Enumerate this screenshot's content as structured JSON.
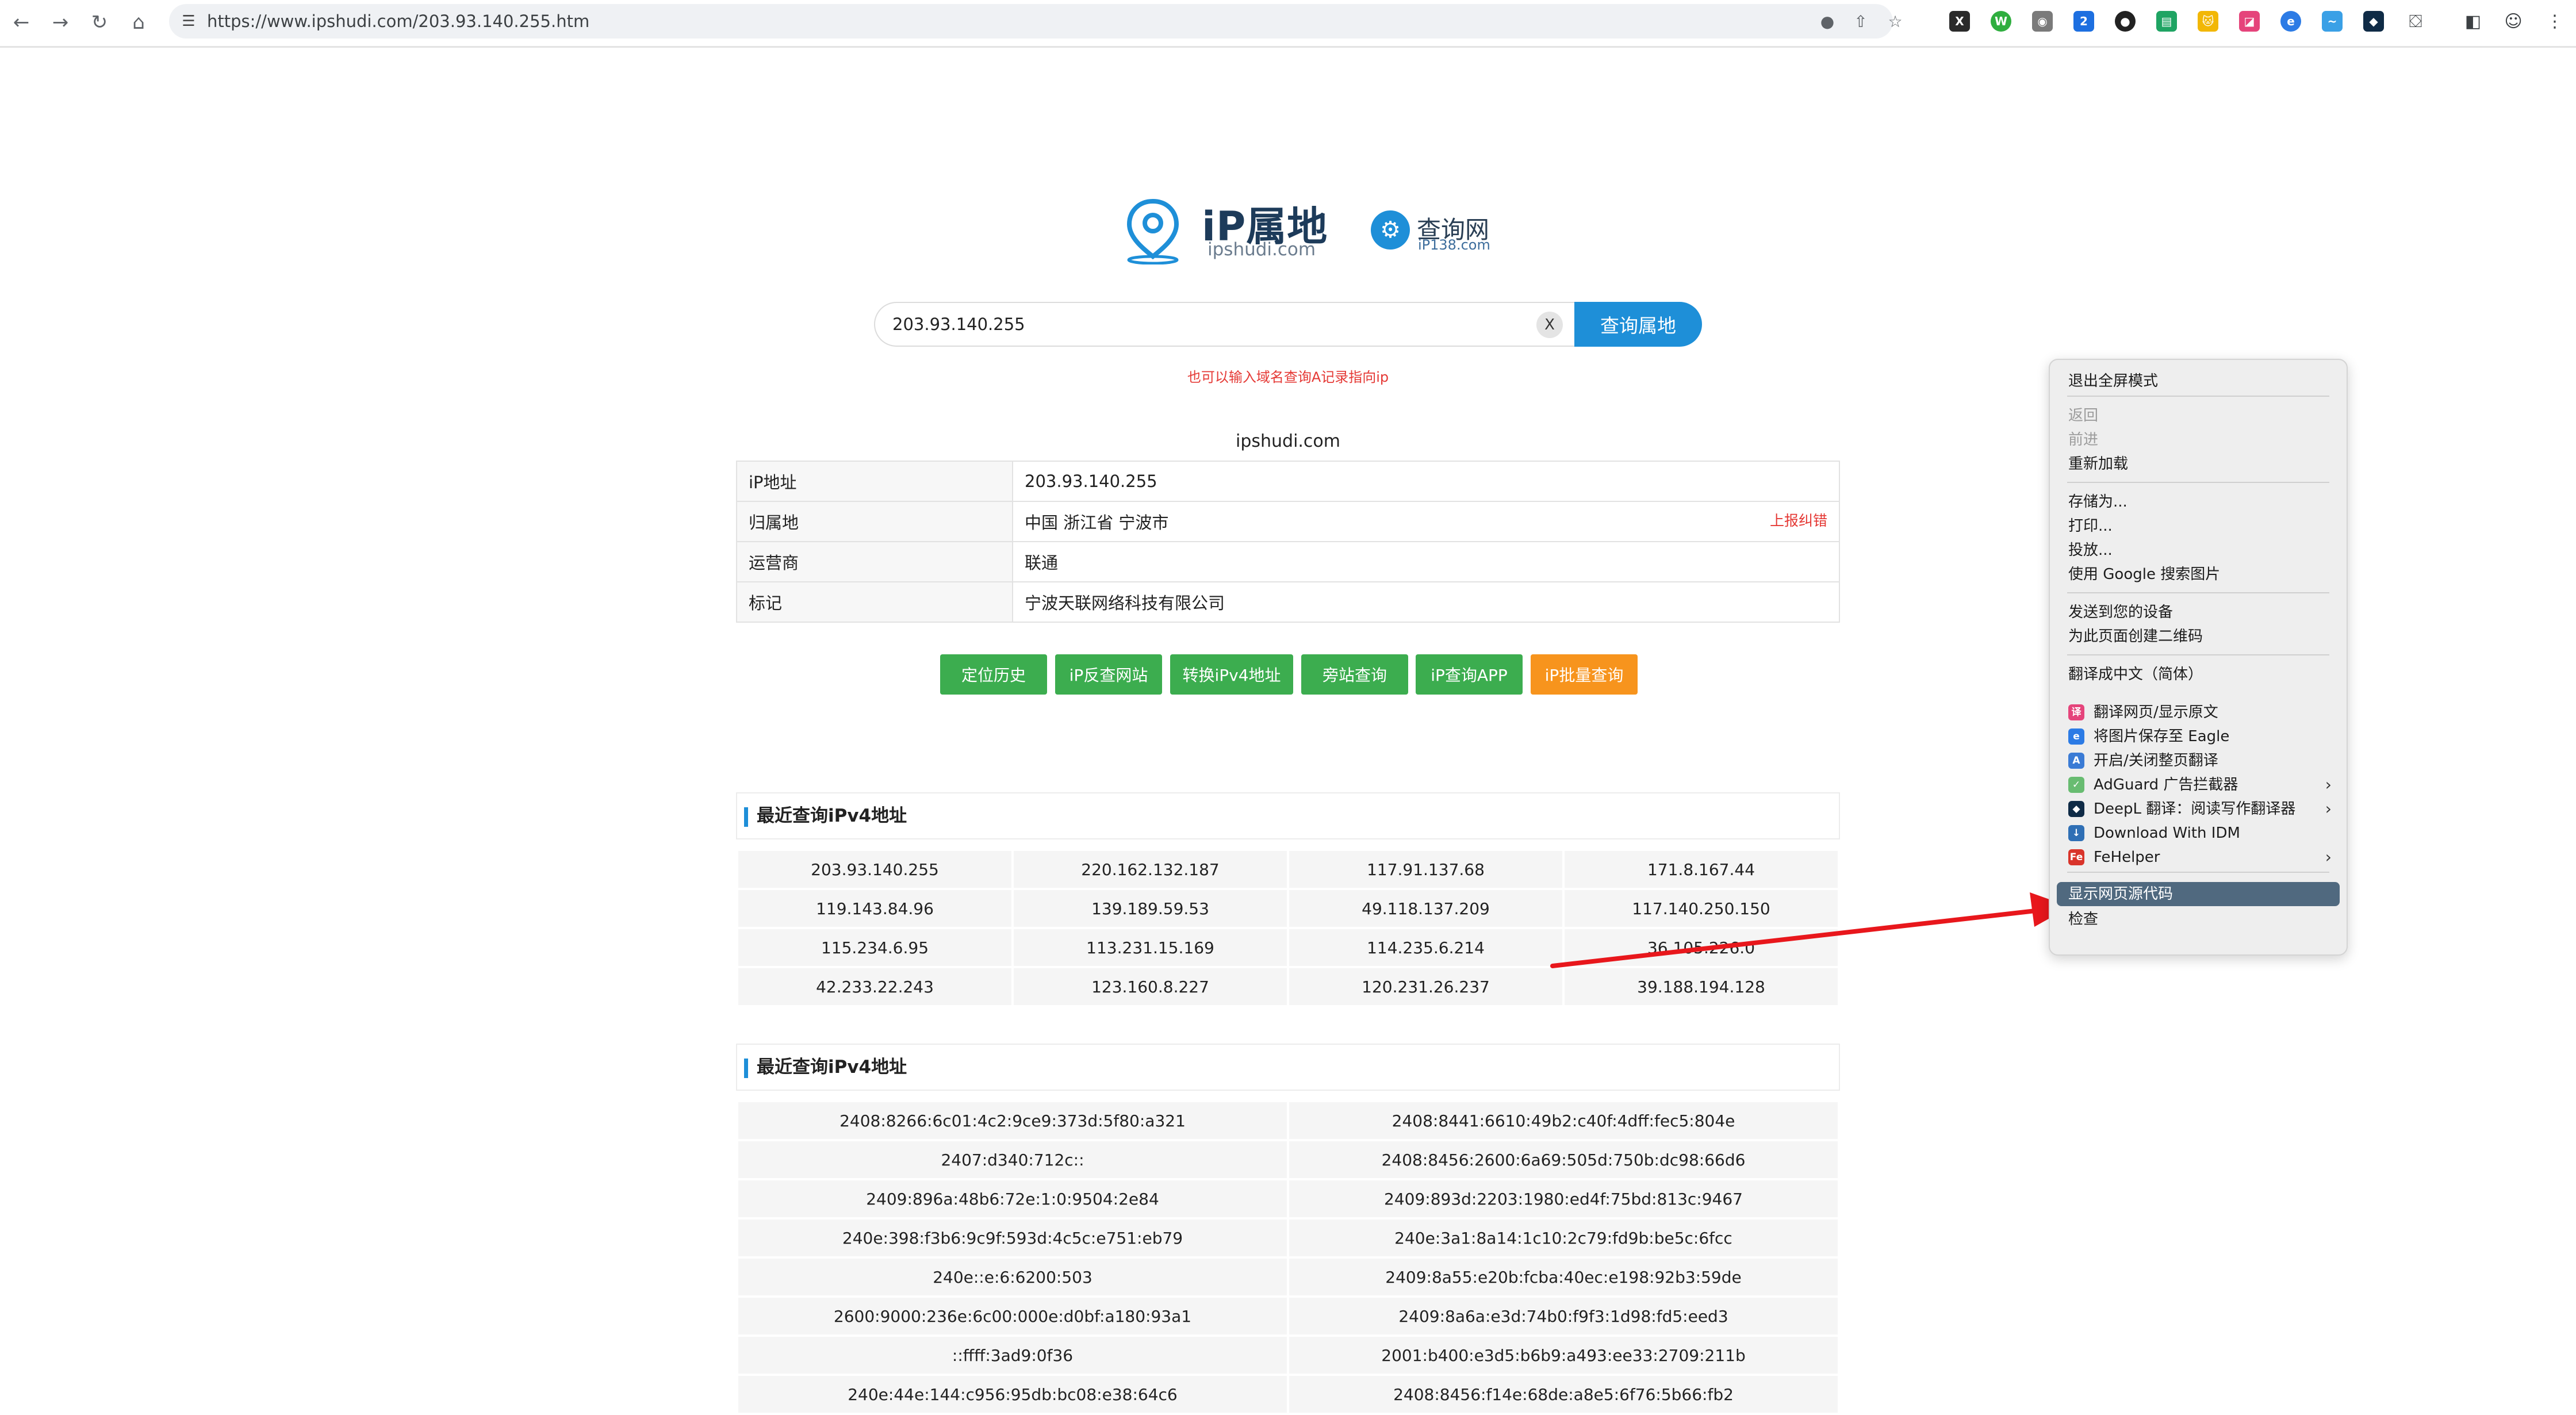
{
  "browser": {
    "url": "https://www.ipshudi.com/203.93.140.255.htm",
    "extensions": [
      "X",
      "W",
      "◉",
      "2",
      "●",
      "▤",
      "🐱",
      "◪",
      "e",
      "~",
      "◆"
    ]
  },
  "logo": {
    "main": "iP属地",
    "sub": "ipshudi.com",
    "partner_main": "查询网",
    "partner_sub": "iP138.com"
  },
  "search": {
    "value": "203.93.140.255",
    "clear_label": "X",
    "button": "查询属地",
    "hint": "也可以输入域名查询A记录指向ip"
  },
  "site_label": "ipshudi.com",
  "info": {
    "rows": [
      {
        "key": "iP地址",
        "value": "203.93.140.255"
      },
      {
        "key": "归属地",
        "value": "中国 浙江省 宁波市",
        "extra": "上报纠错"
      },
      {
        "key": "运营商",
        "value": "联通"
      },
      {
        "key": "标记",
        "value": "宁波天联网络科技有限公司"
      }
    ]
  },
  "actions": [
    "定位历史",
    "iP反查网站",
    "转换iPv4地址",
    "旁站查询",
    "iP查询APP",
    "iP批量查询"
  ],
  "colors": {
    "green": "#3cad4f",
    "orange": "#f7941d",
    "blue": "#1e8fd8",
    "menu_selected": "#50697f",
    "arrow": "#e8171c"
  },
  "recent_v4": {
    "title": "最近查询iPv4地址",
    "rows": [
      [
        "203.93.140.255",
        "220.162.132.187",
        "117.91.137.68",
        "171.8.167.44"
      ],
      [
        "119.143.84.96",
        "139.189.59.53",
        "49.118.137.209",
        "117.140.250.150"
      ],
      [
        "115.234.6.95",
        "113.231.15.169",
        "114.235.6.214",
        "36.105.226.0"
      ],
      [
        "42.233.22.243",
        "123.160.8.227",
        "120.231.26.237",
        "39.188.194.128"
      ]
    ]
  },
  "recent_v6": {
    "title": "最近查询iPv4地址",
    "rows": [
      [
        "2408:8266:6c01:4c2:9ce9:373d:5f80:a321",
        "2408:8441:6610:49b2:c40f:4dff:fec5:804e"
      ],
      [
        "2407:d340:712c::",
        "2408:8456:2600:6a69:505d:750b:dc98:66d6"
      ],
      [
        "2409:896a:48b6:72e:1:0:9504:2e84",
        "2409:893d:2203:1980:ed4f:75bd:813c:9467"
      ],
      [
        "240e:398:f3b6:9c9f:593d:4c5c:e751:eb79",
        "240e:3a1:8a14:1c10:2c79:fd9b:be5c:6fcc"
      ],
      [
        "240e::e:6:6200:503",
        "2409:8a55:e20b:fcba:40ec:e198:92b3:59de"
      ],
      [
        "2600:9000:236e:6c00:000e:d0bf:a180:93a1",
        "2409:8a6a:e3d:74b0:f9f3:1d98:fd5:eed3"
      ],
      [
        "::ffff:3ad9:0f36",
        "2001:b400:e3d5:b6b9:a493:ee33:2709:211b"
      ],
      [
        "240e:44e:144:c956:95db:bc08:e38:64c6",
        "2408:8456:f14e:68de:a8e5:6f76:5b66:fb2"
      ]
    ]
  },
  "context_menu": {
    "items": [
      {
        "label": "退出全屏模式"
      },
      {
        "label": "返回",
        "disabled": true
      },
      {
        "label": "前进",
        "disabled": true
      },
      {
        "label": "重新加载"
      },
      {
        "label": "存储为..."
      },
      {
        "label": "打印..."
      },
      {
        "label": "投放..."
      },
      {
        "label": "使用 Google 搜索图片"
      },
      {
        "label": "发送到您的设备"
      },
      {
        "label": "为此页面创建二维码"
      },
      {
        "label": "翻译成中文（简体）"
      },
      {
        "label": "翻译网页/显示原文",
        "icon": "translate-icon"
      },
      {
        "label": "将图片保存至 Eagle",
        "icon": "eagle-icon"
      },
      {
        "label": "开启/关闭整页翻译",
        "icon": "page-translate-icon"
      },
      {
        "label": "AdGuard 广告拦截器",
        "icon": "adguard-shield-icon",
        "submenu": true
      },
      {
        "label": "DeepL 翻译：阅读写作翻译器",
        "icon": "deepl-icon",
        "submenu": true
      },
      {
        "label": "Download With IDM",
        "icon": "idm-icon"
      },
      {
        "label": "FeHelper",
        "icon": "fehelper-icon",
        "submenu": true
      },
      {
        "label": "显示网页源代码",
        "selected": true
      },
      {
        "label": "检查"
      }
    ]
  }
}
